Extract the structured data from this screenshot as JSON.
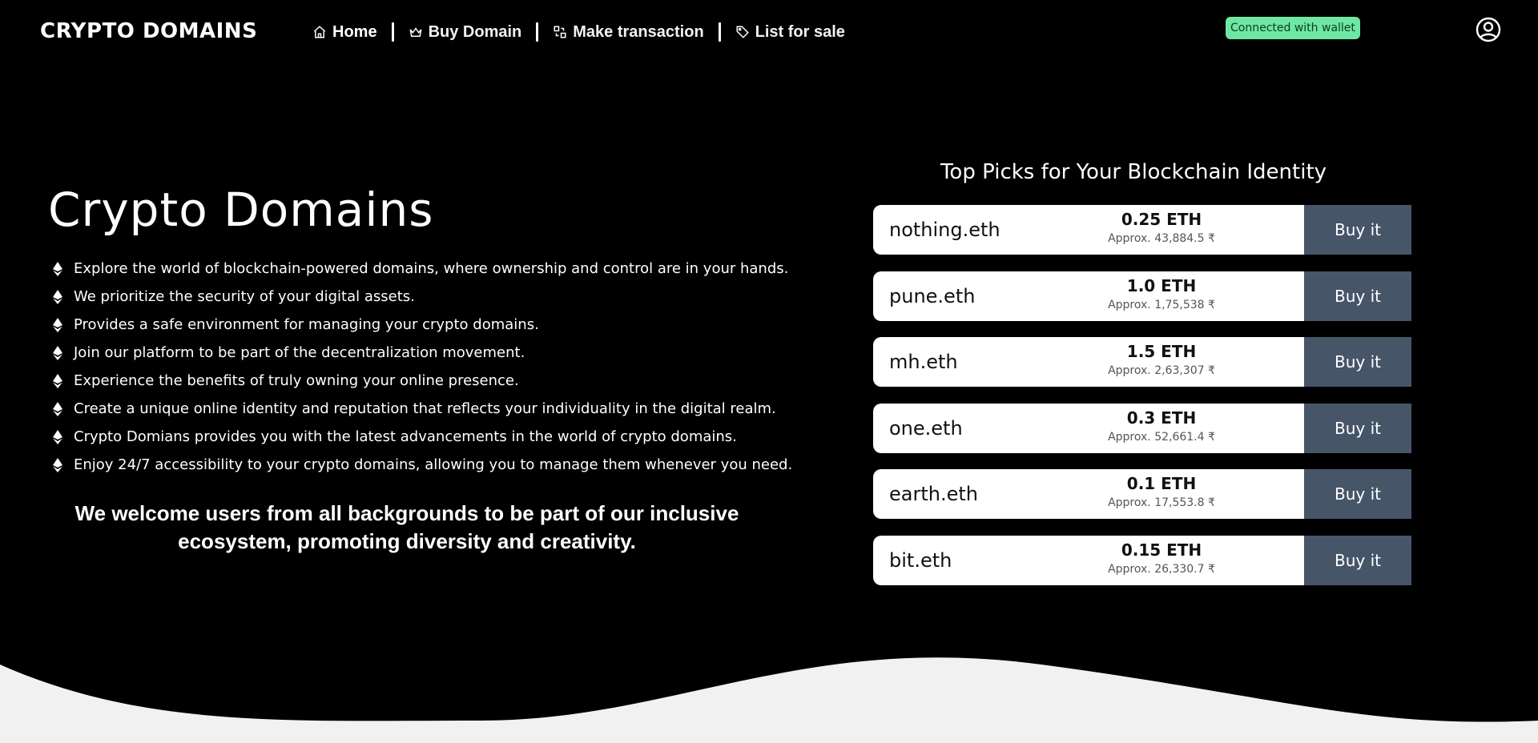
{
  "header": {
    "brand": "CRYPTO DOMAINS",
    "nav": [
      {
        "label": "Home",
        "icon": "home-icon"
      },
      {
        "label": "Buy Domain",
        "icon": "crown-icon"
      },
      {
        "label": "Make transaction",
        "icon": "transaction-icon"
      },
      {
        "label": "List for sale",
        "icon": "tag-icon"
      }
    ],
    "wallet_status": "Connected with wallet",
    "colors": {
      "wallet_badge": "#6ee7a3",
      "buy_button": "#475569"
    }
  },
  "hero": {
    "title": "Crypto Domains",
    "features": [
      "Explore the world of blockchain-powered domains, where ownership and control are in your hands.",
      "We prioritize the security of your digital assets.",
      "Provides a safe environment for managing your crypto domains.",
      "Join our platform to be part of the decentralization movement.",
      "Experience the benefits of truly owning your online presence.",
      "Create a unique online identity and reputation that reflects your individuality in the digital realm.",
      "Crypto Domians provides you with the latest advancements in the world of crypto domains.",
      "Enjoy 24/7 accessibility to your crypto domains, allowing you to manage them whenever you need."
    ],
    "welcome": "We welcome users from all backgrounds to be part of our inclusive ecosystem, promoting diversity and creativity."
  },
  "picks": {
    "title": "Top Picks for Your Blockchain Identity",
    "buy_label": "Buy it",
    "items": [
      {
        "name": "nothing.eth",
        "eth": "0.25 ETH",
        "inr": "Approx. 43,884.5 ₹"
      },
      {
        "name": "pune.eth",
        "eth": "1.0 ETH",
        "inr": "Approx. 1,75,538 ₹"
      },
      {
        "name": "mh.eth",
        "eth": "1.5 ETH",
        "inr": "Approx. 2,63,307 ₹"
      },
      {
        "name": "one.eth",
        "eth": "0.3 ETH",
        "inr": "Approx. 52,661.4 ₹"
      },
      {
        "name": "earth.eth",
        "eth": "0.1 ETH",
        "inr": "Approx. 17,553.8 ₹"
      },
      {
        "name": "bit.eth",
        "eth": "0.15 ETH",
        "inr": "Approx. 26,330.7 ₹"
      }
    ]
  }
}
